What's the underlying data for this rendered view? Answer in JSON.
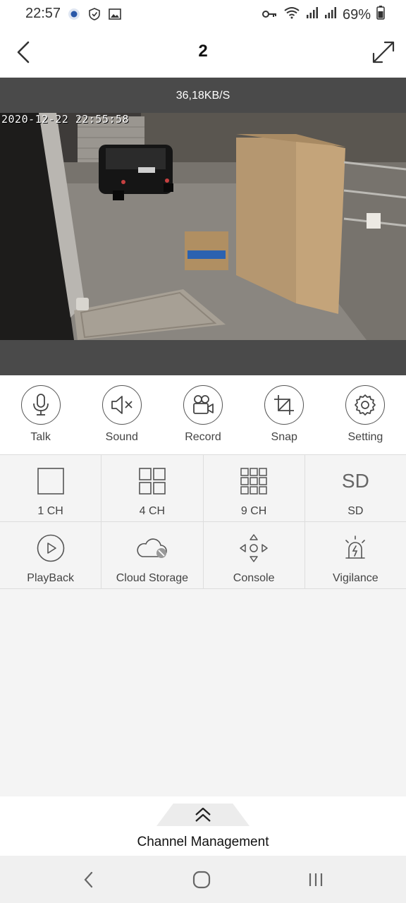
{
  "status_bar": {
    "time": "22:57",
    "battery": "69%",
    "icons": [
      "app-notification-icon",
      "shield-icon",
      "gallery-icon",
      "key-icon",
      "wifi-icon",
      "signal-icon",
      "signal-icon",
      "battery-icon"
    ]
  },
  "header": {
    "title": "2",
    "back_icon": "chevron-left-icon",
    "fullscreen_icon": "expand-icon"
  },
  "video": {
    "speed": "36,18KB/S",
    "timestamp": "2020-12-22 22:55:58"
  },
  "toolbar": {
    "items": [
      {
        "label": "Talk",
        "icon": "microphone-icon"
      },
      {
        "label": "Sound",
        "icon": "speaker-muted-icon"
      },
      {
        "label": "Record",
        "icon": "video-camera-icon"
      },
      {
        "label": "Snap",
        "icon": "crop-icon"
      },
      {
        "label": "Setting",
        "icon": "gear-icon"
      }
    ]
  },
  "grid": {
    "row1": [
      {
        "label": "1 CH",
        "icon": "single-view-icon"
      },
      {
        "label": "4 CH",
        "icon": "quad-view-icon"
      },
      {
        "label": "9 CH",
        "icon": "nine-view-icon"
      },
      {
        "label": "SD",
        "icon_text": "SD"
      }
    ],
    "row2": [
      {
        "label": "PlayBack",
        "icon": "play-icon"
      },
      {
        "label": "Cloud Storage",
        "icon": "cloud-disabled-icon"
      },
      {
        "label": "Console",
        "icon": "direction-pad-icon"
      },
      {
        "label": "Vigilance",
        "icon": "alarm-light-icon"
      }
    ]
  },
  "channel_management": {
    "label": "Channel Management",
    "icon": "double-chevron-up-icon"
  },
  "nav_bar": {
    "icons": [
      "nav-back-icon",
      "nav-home-icon",
      "nav-recents-icon"
    ]
  },
  "colors": {
    "background": "#f4f4f4",
    "video_frame": "#4a4a4a",
    "toolbar_bg": "#ffffff"
  }
}
